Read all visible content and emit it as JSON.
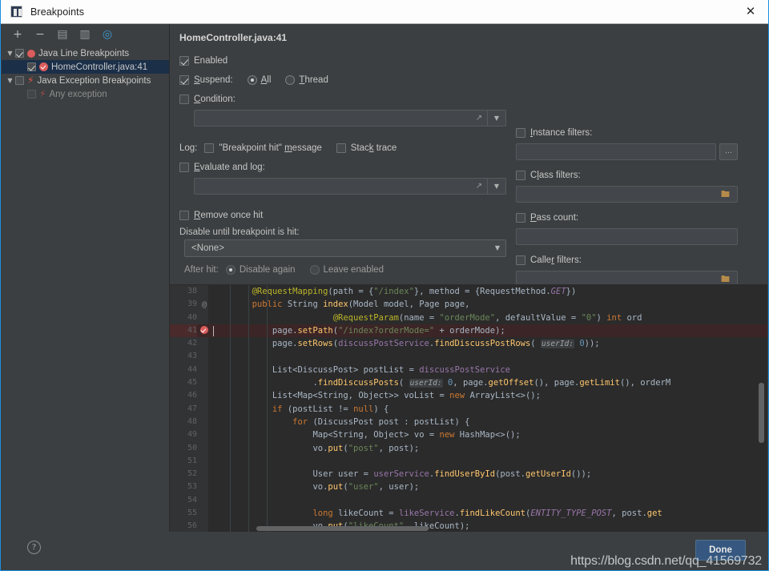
{
  "window": {
    "title": "Breakpoints",
    "icon": "intellij-idea-icon",
    "close_label": "✕",
    "accent_color": "#1a8fe0"
  },
  "tree_toolbar": {
    "items": [
      {
        "name": "add-breakpoint-button",
        "glyph": "+"
      },
      {
        "name": "remove-breakpoint-button",
        "glyph": "−"
      },
      {
        "name": "mute-breakpoints-button",
        "glyph": "▤"
      },
      {
        "name": "view-breakpoints-source-button",
        "glyph": "▥"
      },
      {
        "name": "group-by-button",
        "glyph": "◎"
      }
    ]
  },
  "tree": {
    "items": [
      {
        "label": "Java Line Breakpoints",
        "expanded": true,
        "checked": true,
        "icon": "breakpoint-dot-icon",
        "depth": 0,
        "selected": false,
        "dim": false
      },
      {
        "label": "HomeController.java:41",
        "expanded": null,
        "checked": true,
        "icon": "breakpoint-verified-icon",
        "depth": 1,
        "selected": true,
        "dim": false
      },
      {
        "label": "Java Exception Breakpoints",
        "expanded": true,
        "checked": false,
        "icon": "exception-bolt-icon",
        "depth": 0,
        "selected": false,
        "dim": false
      },
      {
        "label": "Any exception",
        "expanded": null,
        "checked": false,
        "icon": "exception-bolt-icon",
        "depth": 1,
        "selected": false,
        "dim": true
      }
    ]
  },
  "details": {
    "title": "HomeController.java:41",
    "enabled": {
      "label": "Enabled",
      "checked": true
    },
    "suspend": {
      "label": "Suspend:",
      "checked": true,
      "options": [
        {
          "label": "All",
          "mnemonic": "A",
          "selected": true
        },
        {
          "label": "Thread",
          "mnemonic": "T",
          "selected": false
        }
      ]
    },
    "condition": {
      "label": "Condition:",
      "checked": false,
      "value": ""
    },
    "log": {
      "prefix": "Log:",
      "breakpoint_hit_message": {
        "label": "\"Breakpoint hit\" message",
        "checked": false
      },
      "stack_trace": {
        "label": "Stack trace",
        "checked": false
      },
      "evaluate_and_log": {
        "label": "Evaluate and log:",
        "checked": false,
        "value": ""
      }
    },
    "remove_once_hit": {
      "label": "Remove once hit",
      "checked": false
    },
    "disable_until": {
      "label": "Disable until breakpoint is hit:",
      "value": "<None>",
      "options": [
        "<None>"
      ]
    },
    "after_hit": {
      "label": "After hit:",
      "options": [
        {
          "label": "Disable again",
          "selected": true
        },
        {
          "label": "Leave enabled",
          "selected": false
        }
      ]
    },
    "instance_filters": {
      "label": "Instance filters:",
      "checked": false,
      "value": "",
      "button": "…"
    },
    "class_filters": {
      "label": "Class filters:",
      "checked": false,
      "value": "",
      "icon": "folder-icon"
    },
    "pass_count": {
      "label": "Pass count:",
      "checked": false,
      "value": ""
    },
    "caller_filters": {
      "label": "Caller filters:",
      "checked": false,
      "value": "",
      "icon": "folder-icon"
    }
  },
  "editor": {
    "highlighted_line": 41,
    "lines": [
      {
        "num": 38,
        "mark": "",
        "html": "        <span class='a'>@RequestMapping</span><span class='p'>(</span><span class='t'>path</span> <span class='p'>=</span> <span class='p'>{</span><span class='s'>\"/index\"</span><span class='p'>},</span> <span class='t'>method</span> <span class='p'>=</span> <span class='p'>{</span><span class='t'>RequestMethod.</span><span class='i'>GET</span><span class='p'>})</span>"
      },
      {
        "num": 39,
        "mark": "at",
        "html": "        <span class='k'>public</span> <span class='t'>String</span> <span class='m'>index</span><span class='p'>(</span><span class='t'>Model model</span><span class='p'>,</span> <span class='t'>Page page</span><span class='p'>,</span>"
      },
      {
        "num": 40,
        "mark": "",
        "html": "                        <span class='a'>@RequestParam</span><span class='p'>(</span><span class='t'>name</span> <span class='p'>=</span> <span class='s'>\"orderMode\"</span><span class='p'>,</span> <span class='t'>defaultValue</span> <span class='p'>=</span> <span class='s'>\"0\"</span><span class='p'>)</span> <span class='k'>int</span> <span class='t'>ord</span>"
      },
      {
        "num": 41,
        "mark": "bp",
        "html": "            <span class='t'>page.</span><span class='m'>setPath</span><span class='p'>(</span><span class='s'>\"/index?orderMode=\"</span> <span class='p'>+</span> <span class='t'>orderMode</span><span class='p'>);</span>"
      },
      {
        "num": 42,
        "mark": "",
        "html": "            <span class='t'>page.</span><span class='m'>setRows</span><span class='p'>(</span><span class='c'>discussPostService</span><span class='t'>.</span><span class='m'>findDiscussPostRows</span><span class='p'>(</span> <span class='hint'>userId:</span> <span class='n'>0</span><span class='p'>));</span>"
      },
      {
        "num": 43,
        "mark": "",
        "html": ""
      },
      {
        "num": 44,
        "mark": "",
        "html": "            <span class='t'>List&lt;DiscussPost&gt; postList</span> <span class='p'>=</span> <span class='c'>discussPostService</span>"
      },
      {
        "num": 45,
        "mark": "",
        "html": "                    <span class='t'>.</span><span class='m'>findDiscussPosts</span><span class='p'>(</span> <span class='hint'>userId:</span> <span class='n'>0</span><span class='p'>,</span> <span class='t'>page.</span><span class='m'>getOffset</span><span class='p'>(),</span> <span class='t'>page.</span><span class='m'>getLimit</span><span class='p'>(),</span> <span class='t'>orderM</span>"
      },
      {
        "num": 46,
        "mark": "",
        "html": "            <span class='t'>List&lt;Map&lt;String, Object&gt;&gt; voList</span> <span class='p'>=</span> <span class='k'>new</span> <span class='t'>ArrayList&lt;&gt;();</span>"
      },
      {
        "num": 47,
        "mark": "",
        "html": "            <span class='k'>if</span> <span class='p'>(</span><span class='t'>postList</span> <span class='p'>!=</span> <span class='k'>null</span><span class='p'>) {</span>"
      },
      {
        "num": 48,
        "mark": "",
        "html": "                <span class='k'>for</span> <span class='p'>(</span><span class='t'>DiscussPost post : postList</span><span class='p'>) {</span>"
      },
      {
        "num": 49,
        "mark": "",
        "html": "                    <span class='t'>Map&lt;String, Object&gt; vo</span> <span class='p'>=</span> <span class='k'>new</span> <span class='t'>HashMap&lt;&gt;();</span>"
      },
      {
        "num": 50,
        "mark": "",
        "html": "                    <span class='t'>vo.</span><span class='m'>put</span><span class='p'>(</span><span class='s'>\"post\"</span><span class='p'>,</span> <span class='t'>post</span><span class='p'>);</span>"
      },
      {
        "num": 51,
        "mark": "",
        "html": ""
      },
      {
        "num": 52,
        "mark": "",
        "html": "                    <span class='t'>User user</span> <span class='p'>=</span> <span class='c'>userService</span><span class='t'>.</span><span class='m'>findUserById</span><span class='p'>(</span><span class='t'>post.</span><span class='m'>getUserId</span><span class='p'>());</span>"
      },
      {
        "num": 53,
        "mark": "",
        "html": "                    <span class='t'>vo.</span><span class='m'>put</span><span class='p'>(</span><span class='s'>\"user\"</span><span class='p'>,</span> <span class='t'>user</span><span class='p'>);</span>"
      },
      {
        "num": 54,
        "mark": "",
        "html": ""
      },
      {
        "num": 55,
        "mark": "",
        "html": "                    <span class='k'>long</span> <span class='t'>likeCount</span> <span class='p'>=</span> <span class='c'>likeService</span><span class='t'>.</span><span class='m'>findLikeCount</span><span class='p'>(</span><span class='i'>ENTITY_TYPE_POST</span><span class='p'>,</span> <span class='t'>post.</span><span class='m'>get</span>"
      },
      {
        "num": 56,
        "mark": "",
        "html": "                    <span class='t'>vo.</span><span class='m'>put</span><span class='p'>(</span><span class='s'>\"likeCount\"</span><span class='p'>,</span> <span class='t'>likeCount</span><span class='p'>);</span>"
      }
    ]
  },
  "footer": {
    "help_label": "?",
    "done_label": "Done",
    "watermark": "https://blog.csdn.net/qq_41569732"
  }
}
